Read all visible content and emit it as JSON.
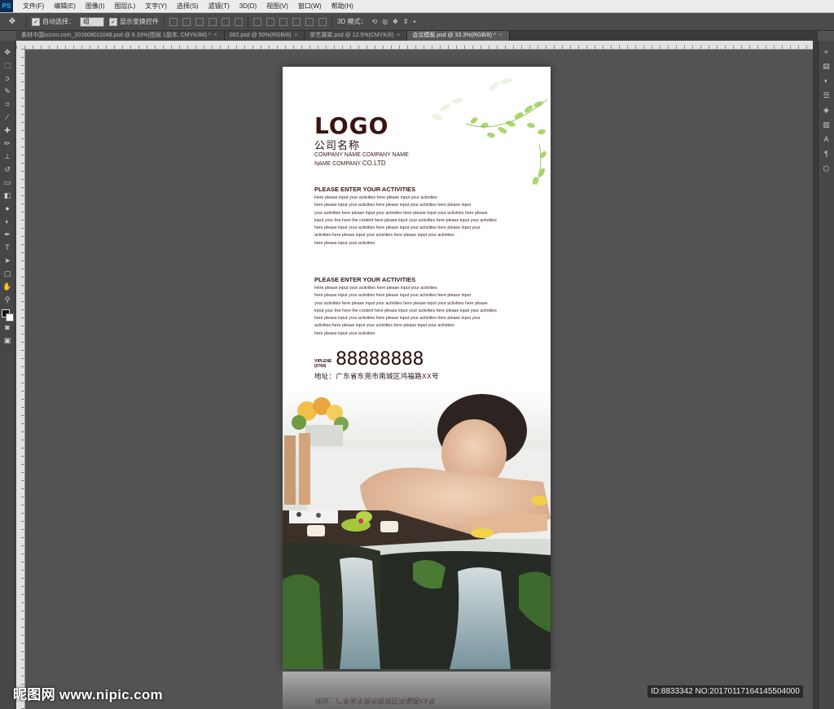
{
  "app": {
    "logo": "PS"
  },
  "menu": [
    "文件(F)",
    "编辑(E)",
    "图像(I)",
    "图层(L)",
    "文字(Y)",
    "选择(S)",
    "滤镜(T)",
    "3D(D)",
    "视图(V)",
    "窗口(W)",
    "帮助(H)"
  ],
  "options": {
    "auto_select": "自动选择：",
    "auto_select_value": "组",
    "show_transform": "显示变换控件",
    "mode_3d": "3D 模式："
  },
  "tabs": [
    {
      "label": "素材中国sccnn.com_201608011048.psd @ 8.33%(图层 1副本, CMYK/8#) *",
      "active": false
    },
    {
      "label": "002.psd @ 50%(RGB/8)",
      "active": false
    },
    {
      "label": "茶艺展架.psd @ 12.5%(CMYK/8)",
      "active": false
    },
    {
      "label": "会议模板.psd @ 33.3%(RGB/8) *",
      "active": true
    }
  ],
  "document": {
    "logo": "LOGO",
    "company_cn": "公司名称",
    "company_en_1": "COMPANY NAME COMPANY NAME",
    "company_en_2a": "NAME COMPANY ",
    "company_en_2b": "CO.LTD",
    "section1_title": "PLEASE ENTER YOUR ACTIVITIES",
    "section2_title": "PLEASE ENTER YOUR ACTIVITIES",
    "paragraph": [
      "Here please input your activities here please input your activities",
      "here please input your activities here please input your activities here please input",
      "your activities here please input your activities here please input your activities here please",
      "input your live here the content here please input your activities here please input your activities",
      "here please input your activities here please input your activities here please input your",
      "activities here please input your activities here please input your activities",
      "here please input your activities"
    ],
    "phone_label_1": "VIPLENE",
    "phone_label_2": "(0769)",
    "phone": "88888888",
    "address": "地址：广东省东莞市南城区鸿福路XX号"
  },
  "reflection_text": "地址：广东省东莞市南城区鸿福路XX号",
  "watermark": {
    "site": "昵图网 www.nipic.com",
    "id": "ID:8833342 NO:20170117164145504000"
  },
  "colors": {
    "workspace": "#535353",
    "text_brown": "#3a1a1a",
    "leaf_green": "#8cc63f"
  }
}
